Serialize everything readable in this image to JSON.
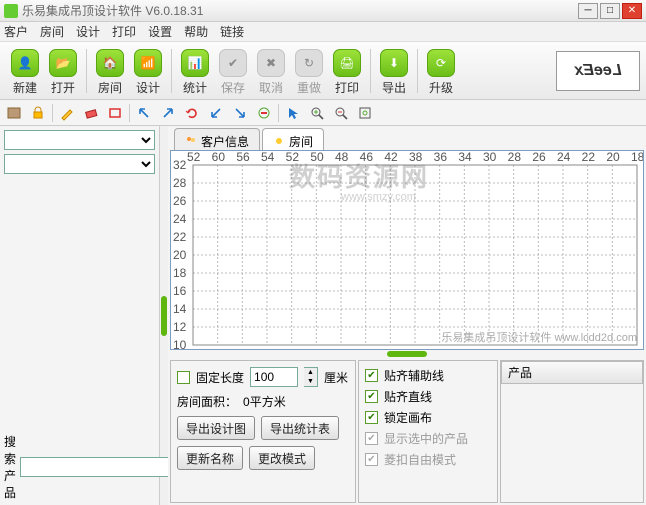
{
  "window": {
    "title": "乐易集成吊顶设计软件  V6.0.18.31"
  },
  "menu": [
    "客户",
    "房间",
    "设计",
    "打印",
    "设置",
    "帮助",
    "链接"
  ],
  "toolbar": [
    {
      "label": "新建",
      "glyph": "👤",
      "style": "green"
    },
    {
      "label": "打开",
      "glyph": "📂",
      "style": "green"
    },
    {
      "sep": true
    },
    {
      "label": "房间",
      "glyph": "🏠",
      "style": "green"
    },
    {
      "label": "设计",
      "glyph": "📶",
      "style": "green"
    },
    {
      "sep": true
    },
    {
      "label": "统计",
      "glyph": "📊",
      "style": "green"
    },
    {
      "label": "保存",
      "glyph": "✔",
      "style": "grey",
      "muted": true
    },
    {
      "label": "取消",
      "glyph": "✖",
      "style": "grey",
      "muted": true
    },
    {
      "label": "重做",
      "glyph": "↻",
      "style": "grey",
      "muted": true
    },
    {
      "label": "打印",
      "glyph": "🖨",
      "style": "green"
    },
    {
      "sep": true
    },
    {
      "label": "导出",
      "glyph": "⬇",
      "style": "green"
    },
    {
      "sep": true
    },
    {
      "label": "升级",
      "glyph": "⟳",
      "style": "green"
    }
  ],
  "logo_text": "LeeEx",
  "subtool_names": [
    "book-icon",
    "lock-icon",
    "sep",
    "pencil-icon",
    "eraser-icon",
    "rect-icon",
    "sep",
    "arrow-nw-icon",
    "arrow-ne-icon",
    "rotate-icon",
    "arrow-sw-icon",
    "arrow-se-icon",
    "circle-minus-icon",
    "sep",
    "cursor-icon",
    "zoom-in-icon",
    "zoom-out-icon",
    "fit-icon"
  ],
  "tabs": [
    {
      "label": "客户信息",
      "active": false
    },
    {
      "label": "房间",
      "active": true
    }
  ],
  "chart_data": {
    "type": "grid",
    "y_ticks": [
      "32",
      "28",
      "26",
      "24",
      "22",
      "20",
      "18",
      "16",
      "14",
      "12",
      "10"
    ],
    "x_ticks": [
      "52",
      "60",
      "56",
      "54",
      "52",
      "50",
      "48",
      "46",
      "42",
      "38",
      "36",
      "34",
      "30",
      "28",
      "26",
      "24",
      "22",
      "20",
      "18"
    ],
    "watermark_main": "数码资源网",
    "watermark_sub": "www.smzy.com",
    "watermark_footer": "乐易集成吊顶设计软件  www.lcdd2d.com"
  },
  "bottom": {
    "fixed_length_label": "固定长度",
    "fixed_length_value": "100",
    "unit": "厘米",
    "room_area_label": "房间面积：",
    "room_area_value": "0平方米",
    "btn_export_design": "导出设计图",
    "btn_export_stats": "导出统计表",
    "btn_update_name": "更新名称",
    "btn_change_mode": "更改模式",
    "chk_snap_guide": "贴齐辅助线",
    "chk_snap_line": "贴齐直线",
    "chk_lock_canvas": "锁定画布",
    "chk_show_sel": "显示选中的产品",
    "chk_free_mode": "菱扣自由模式",
    "product_header": "产品"
  },
  "sidebar": {
    "search_label": "搜索产品",
    "search_button": "▶"
  }
}
